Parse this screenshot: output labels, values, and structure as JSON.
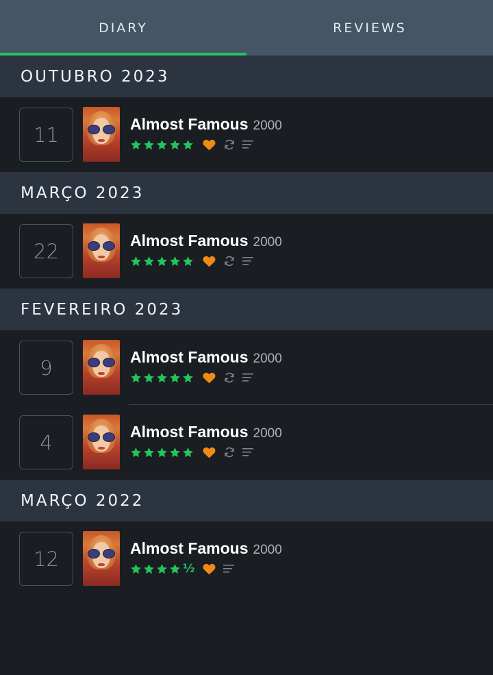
{
  "tabs": [
    {
      "label": "DIARY",
      "active": true
    },
    {
      "label": "REVIEWS",
      "active": false
    }
  ],
  "colors": {
    "accent_green": "#22c55e",
    "heart_orange": "#f08a14",
    "tab_bar": "#445566",
    "month_header": "#2c3440",
    "background": "#1a1d22"
  },
  "months": [
    {
      "label": "OUTUBRO 2023",
      "entries": [
        {
          "day": "11",
          "title": "Almost Famous",
          "year": "2000",
          "rating": "★★★★★",
          "liked": true,
          "rewatch": true,
          "review": true
        }
      ]
    },
    {
      "label": "MARÇO 2023",
      "entries": [
        {
          "day": "22",
          "title": "Almost Famous",
          "year": "2000",
          "rating": "★★★★★",
          "liked": true,
          "rewatch": true,
          "review": true
        }
      ]
    },
    {
      "label": "FEVEREIRO 2023",
      "entries": [
        {
          "day": "9",
          "title": "Almost Famous",
          "year": "2000",
          "rating": "★★★★★",
          "liked": true,
          "rewatch": true,
          "review": true
        },
        {
          "day": "4",
          "title": "Almost Famous",
          "year": "2000",
          "rating": "★★★★★",
          "liked": true,
          "rewatch": true,
          "review": true
        }
      ]
    },
    {
      "label": "MARÇO 2022",
      "entries": [
        {
          "day": "12",
          "title": "Almost Famous",
          "year": "2000",
          "rating": "★★★★½",
          "liked": true,
          "rewatch": false,
          "review": true
        }
      ]
    }
  ],
  "icons": {
    "star": "star-icon",
    "heart": "heart-icon",
    "rewatch": "rewatch-icon",
    "review": "review-lines-icon"
  }
}
